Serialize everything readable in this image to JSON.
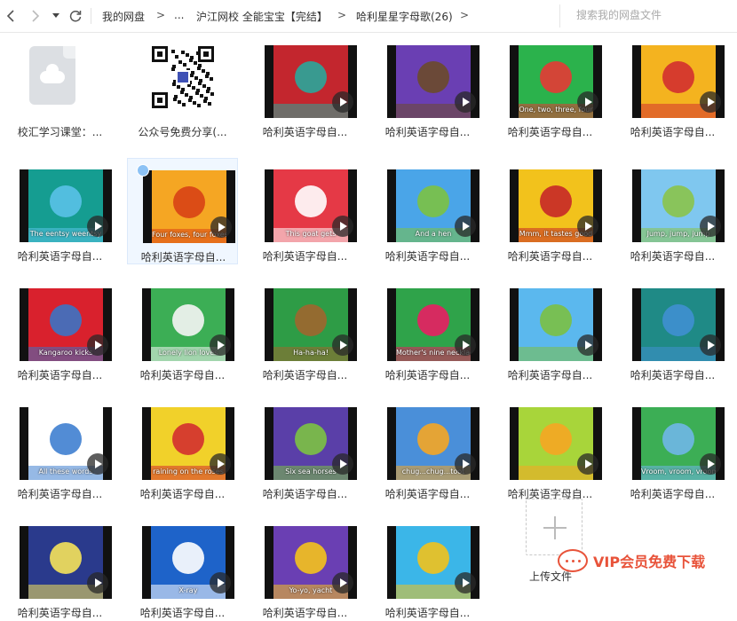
{
  "toolbar": {
    "back_icon": "chevron-left-icon",
    "forward_icon": "chevron-right-icon",
    "history_icon": "caret-down-icon",
    "refresh_icon": "refresh-icon"
  },
  "breadcrumb": {
    "root": "我的网盘",
    "sep": ">",
    "ellipsis": "...",
    "level2": "沪江网校 全能宝宝【完结】",
    "current": "哈利星星字母歌(26)"
  },
  "search": {
    "placeholder": "搜索我的网盘文件"
  },
  "files": [
    {
      "name": "校汇学习课堂：...",
      "kind": "cloud-file"
    },
    {
      "name": "公众号免费分享(...",
      "kind": "qr-image"
    },
    {
      "name": "哈利英语字母自...",
      "kind": "video",
      "caption": "",
      "bg": "#c3262e",
      "accent": "#2aa79b"
    },
    {
      "name": "哈利英语字母自...",
      "kind": "video",
      "caption": "",
      "bg": "#6a3fb3",
      "accent": "#6b4a2a"
    },
    {
      "name": "哈利英语字母自...",
      "kind": "video",
      "caption": "One, two, three, four",
      "bg": "#2bb24c",
      "accent": "#e53935"
    },
    {
      "name": "哈利英语字母自...",
      "kind": "video",
      "caption": "",
      "bg": "#f4b31f",
      "accent": "#d32f2f"
    },
    {
      "name": "哈利英语字母自...",
      "kind": "video",
      "caption": "The eentsy weentsy",
      "bg": "#159d91",
      "accent": "#59c2e8"
    },
    {
      "name": "哈利英语字母自...",
      "kind": "video",
      "caption": "Four foxes, four foxes",
      "bg": "#f5a623",
      "accent": "#d84315",
      "selected": true
    },
    {
      "name": "哈利英语字母自...",
      "kind": "video",
      "caption": "This goat gets",
      "bg": "#e53946",
      "accent": "#ffffff"
    },
    {
      "name": "哈利英语字母自...",
      "kind": "video",
      "caption": "And a hen",
      "bg": "#4aa5e8",
      "accent": "#7cc242"
    },
    {
      "name": "哈利英语字母自...",
      "kind": "video",
      "caption": "Mmm, it tastes good",
      "bg": "#f2c21c",
      "accent": "#c62828"
    },
    {
      "name": "哈利英语字母自...",
      "kind": "video",
      "caption": "Jump, jump, jump",
      "bg": "#7fc7ef",
      "accent": "#8bc34a"
    },
    {
      "name": "哈利英语字母自...",
      "kind": "video",
      "caption": "Kangaroo kicks",
      "bg": "#d9212d",
      "accent": "#3b73c4"
    },
    {
      "name": "哈利英语字母自...",
      "kind": "video",
      "caption": "Lonely lion loves",
      "bg": "#3cae55",
      "accent": "#f5f5f5"
    },
    {
      "name": "哈利英语字母自...",
      "kind": "video",
      "caption": "Ha-ha-ha!",
      "bg": "#2e9c46",
      "accent": "#a0662d"
    },
    {
      "name": "哈利英语字母自...",
      "kind": "video",
      "caption": "Mother's nine necklaces",
      "bg": "#2fa34a",
      "accent": "#e91e63"
    },
    {
      "name": "哈利英语字母自...",
      "kind": "video",
      "caption": "",
      "bg": "#5bb8ee",
      "accent": "#7bc043"
    },
    {
      "name": "哈利英语字母自...",
      "kind": "video",
      "caption": "",
      "bg": "#1f8a86",
      "accent": "#3f8fd2"
    },
    {
      "name": "哈利英语字母自...",
      "kind": "video",
      "caption": "All these words",
      "bg": "#ffffff",
      "accent": "#3f7fd0"
    },
    {
      "name": "哈利英语字母自...",
      "kind": "video",
      "caption": "raining on the roses",
      "bg": "#f1d12a",
      "accent": "#d32f2f"
    },
    {
      "name": "哈利英语字母自...",
      "kind": "video",
      "caption": "Six sea horses",
      "bg": "#5a3fa8",
      "accent": "#7cc242"
    },
    {
      "name": "哈利英语字母自...",
      "kind": "video",
      "caption": "chug...chug...toot",
      "bg": "#4a8fd9",
      "accent": "#f5a623"
    },
    {
      "name": "哈利英语字母自...",
      "kind": "video",
      "caption": "",
      "bg": "#a8d53a",
      "accent": "#f5a623"
    },
    {
      "name": "哈利英语字母自...",
      "kind": "video",
      "caption": "Vroom, vroom, vroom",
      "bg": "#3cae55",
      "accent": "#6fb7e8"
    },
    {
      "name": "哈利英语字母自...",
      "kind": "video",
      "caption": "",
      "bg": "#2a3a8c",
      "accent": "#f5e35a"
    },
    {
      "name": "哈利英语字母自...",
      "kind": "video",
      "caption": "X-ray",
      "bg": "#1e63c9",
      "accent": "#ffffff"
    },
    {
      "name": "哈利英语字母自...",
      "kind": "video",
      "caption": "Yo-yo, yacht",
      "bg": "#6a3fb3",
      "accent": "#f5c21c"
    },
    {
      "name": "哈利英语字母自...",
      "kind": "video",
      "caption": "",
      "bg": "#3bb6e8",
      "accent": "#f2c21c"
    }
  ],
  "upload": {
    "label": "上传文件",
    "icon": "plus-icon"
  },
  "watermark": {
    "text": "VIP会员免费下载",
    "icon": "chat-bubble-icon"
  }
}
